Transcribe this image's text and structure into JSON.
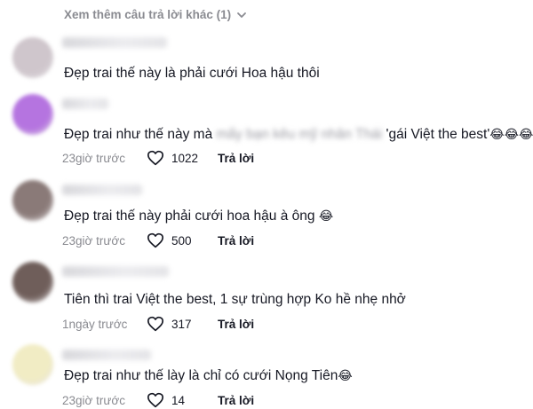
{
  "see_more": {
    "label": "Xem thêm câu trả lời khác (1)"
  },
  "comments": [
    {
      "text": "Đẹp trai thế này là phải cưới Hoa hậu thôi",
      "avatar_color": "#cfc6cc"
    },
    {
      "text_before": "Đẹp trai như thế này mà ",
      "text_blurred": "mấy bạn kêu mỹ nhân Thái",
      "text_after": " 'gái Việt the best'",
      "emoji": "😂😂😂",
      "avatar_color": "#b574e0",
      "time": "23giờ trước",
      "likes": "1022",
      "reply": "Trả lời"
    },
    {
      "text": "Đẹp trai thế này phải cưới hoa hậu à ông",
      "emoji": "😂",
      "avatar_color": "#8a7a78",
      "time": "23giờ trước",
      "likes": "500",
      "reply": "Trả lời"
    },
    {
      "text": "Tiên thì trai Việt the best, 1 sự trùng hợp Ko hề nhẹ nhở",
      "avatar_color": "#6f5e5a",
      "time": "1ngày trước",
      "likes": "317",
      "reply": "Trả lời"
    },
    {
      "text": "Đẹp trai như thế lày là chỉ có cưới Nọng Tiên",
      "emoji": "😂",
      "avatar_color": "#f1ecc4",
      "time": "23giờ trước",
      "likes": "14",
      "reply": "Trả lời"
    }
  ]
}
